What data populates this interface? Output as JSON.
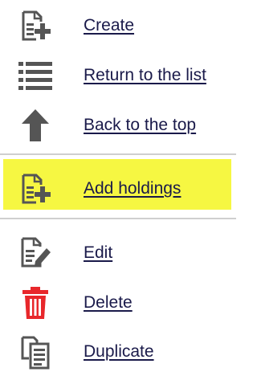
{
  "menu": {
    "items": [
      {
        "label": "Create",
        "icon": "document-add-icon"
      },
      {
        "label": "Return to the list",
        "icon": "list-icon"
      },
      {
        "label": "Back to the top",
        "icon": "arrow-up-icon"
      },
      {
        "label": "Add holdings",
        "icon": "document-add-icon",
        "highlighted": true
      },
      {
        "label": "Edit",
        "icon": "document-edit-icon"
      },
      {
        "label": "Delete",
        "icon": "trash-icon"
      },
      {
        "label": "Duplicate",
        "icon": "copy-icon"
      }
    ]
  },
  "colors": {
    "link_text": "#1a1a4a",
    "icon_gray": "#555555",
    "highlight": "#f6f742",
    "delete_red": "#e8272b",
    "divider": "#cfcfcf"
  }
}
